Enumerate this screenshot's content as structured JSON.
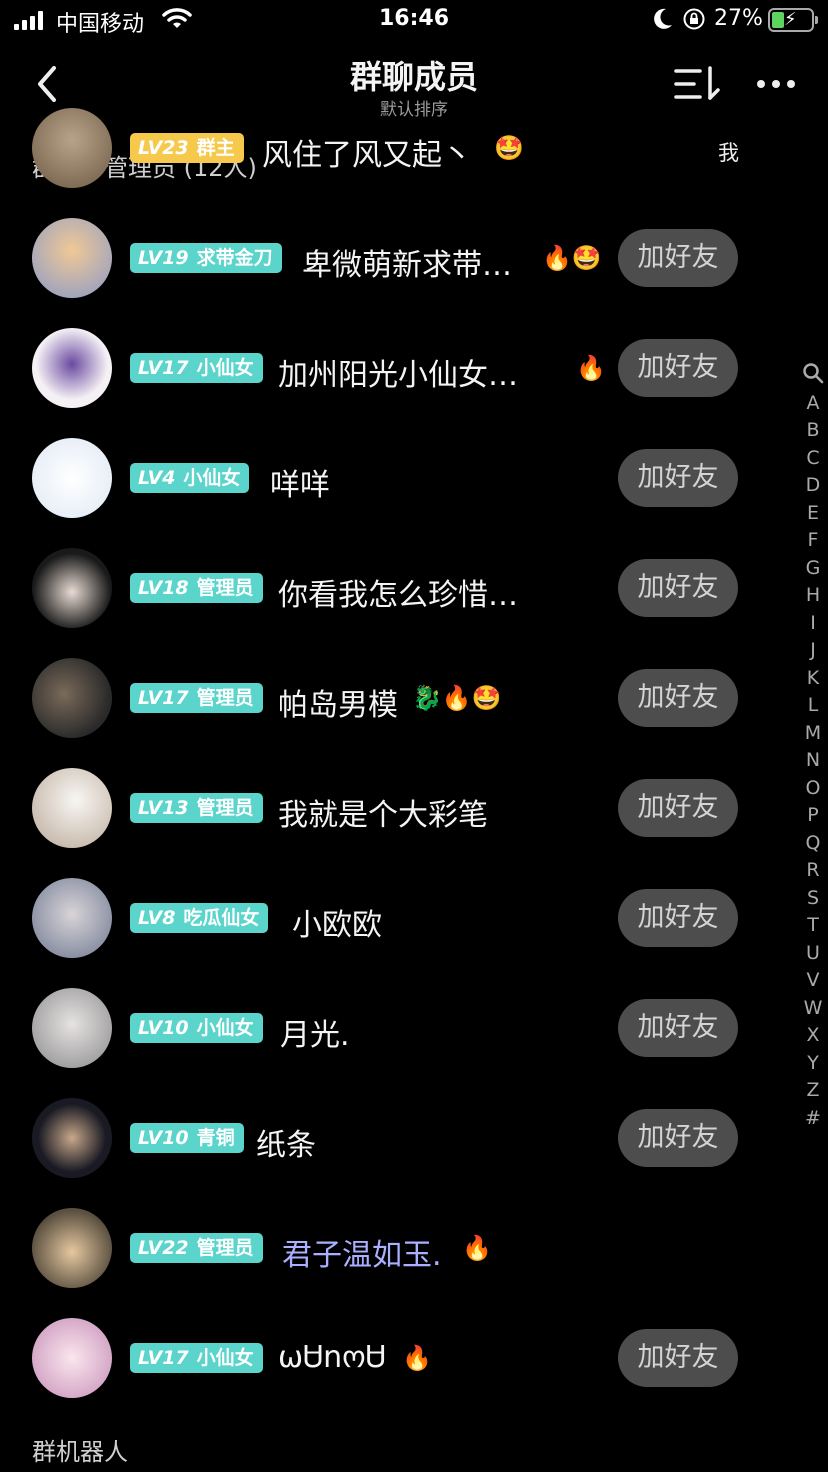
{
  "status": {
    "carrier": "中国移动",
    "time": "16:46",
    "battery": "27%"
  },
  "header": {
    "title": "群聊成员",
    "subtitle": "默认排序",
    "back_icon": "chevron-left-icon",
    "sort_icon": "sort-icon",
    "more_icon": "more-dots-icon"
  },
  "sections": {
    "owner": "群主、管理员 (12人)",
    "bots": "群机器人"
  },
  "add_label": "加好友",
  "me_label": "我",
  "members": [
    {
      "level": "LV23",
      "title": "群主",
      "name": "风住了风又起丶",
      "emojis": "🤩",
      "badge_color": "#f6c84c",
      "is_me": true
    },
    {
      "level": "LV19",
      "title": "求带金刀",
      "name": "卑微萌新求带…",
      "emojis": "🔥🤩"
    },
    {
      "level": "LV17",
      "title": "小仙女",
      "name": "加州阳光小仙女…",
      "emojis": "🔥"
    },
    {
      "level": "LV4",
      "title": "小仙女",
      "name": "咩咩",
      "emojis": ""
    },
    {
      "level": "LV18",
      "title": "管理员",
      "name": "你看我怎么珍惜…",
      "emojis": ""
    },
    {
      "level": "LV17",
      "title": "管理员",
      "name": "帕岛男模",
      "emojis": "🐉🔥🤩"
    },
    {
      "level": "LV13",
      "title": "管理员",
      "name": "我就是个大彩笔",
      "emojis": ""
    },
    {
      "level": "LV8",
      "title": "吃瓜仙女",
      "name": "小欧欧",
      "emojis": ""
    },
    {
      "level": "LV10",
      "title": "小仙女",
      "name": "月光.",
      "emojis": ""
    },
    {
      "level": "LV10",
      "title": "青铜",
      "name": "纸条",
      "emojis": ""
    },
    {
      "level": "LV22",
      "title": "管理员",
      "name": "君子温如玉.",
      "emojis": "🔥",
      "name_color": "#aab0ff",
      "no_add": true
    },
    {
      "level": "LV17",
      "title": "小仙女",
      "name": "ωᏌnოᏌ",
      "emojis": "🔥"
    }
  ],
  "index_letters": [
    "A",
    "B",
    "C",
    "D",
    "E",
    "F",
    "G",
    "H",
    "I",
    "J",
    "K",
    "L",
    "M",
    "N",
    "O",
    "P",
    "Q",
    "R",
    "S",
    "T",
    "U",
    "V",
    "W",
    "X",
    "Y",
    "Z",
    "#"
  ],
  "colors": {
    "badge": "#5bd4cb",
    "owner_badge": "#f6c84c",
    "button_bg": "#4d4d4d",
    "background": "#000000"
  }
}
